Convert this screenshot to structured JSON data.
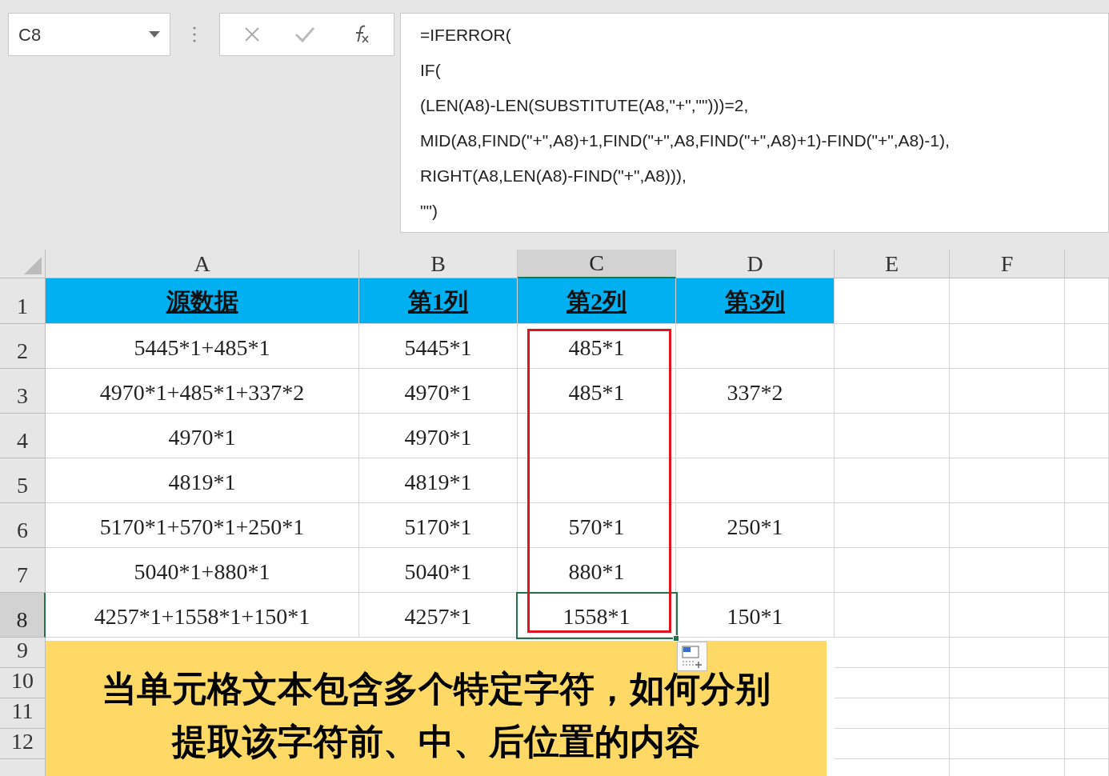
{
  "name_box": {
    "value": "C8"
  },
  "formula_bar": {
    "lines": [
      "=IFERROR(",
      "IF(",
      "(LEN(A8)-LEN(SUBSTITUTE(A8,\"+\",\"\")))=2,",
      "MID(A8,FIND(\"+\",A8)+1,FIND(\"+\",A8,FIND(\"+\",A8)+1)-FIND(\"+\",A8)-1),",
      "RIGHT(A8,LEN(A8)-FIND(\"+\",A8))),",
      "\"\")"
    ]
  },
  "columns": [
    {
      "label": "A",
      "selected": false
    },
    {
      "label": "B",
      "selected": false
    },
    {
      "label": "C",
      "selected": true
    },
    {
      "label": "D",
      "selected": false
    },
    {
      "label": "E",
      "selected": false
    },
    {
      "label": "F",
      "selected": false
    }
  ],
  "rows": [
    {
      "label": "1",
      "kind": "header",
      "selected": false,
      "cells": [
        "源数据",
        "第1列",
        "第2列",
        "第3列"
      ]
    },
    {
      "label": "2",
      "kind": "data",
      "selected": false,
      "cells": [
        "5445*1+485*1",
        "5445*1",
        "485*1",
        null
      ]
    },
    {
      "label": "3",
      "kind": "data",
      "selected": false,
      "cells": [
        "4970*1+485*1+337*2",
        "4970*1",
        "485*1",
        "337*2"
      ]
    },
    {
      "label": "4",
      "kind": "data",
      "selected": false,
      "cells": [
        "4970*1",
        "4970*1",
        null,
        null
      ]
    },
    {
      "label": "5",
      "kind": "data",
      "selected": false,
      "cells": [
        "4819*1",
        "4819*1",
        null,
        null
      ]
    },
    {
      "label": "6",
      "kind": "data",
      "selected": false,
      "cells": [
        "5170*1+570*1+250*1",
        "5170*1",
        "570*1",
        "250*1"
      ]
    },
    {
      "label": "7",
      "kind": "data",
      "selected": false,
      "cells": [
        "5040*1+880*1",
        "5040*1",
        "880*1",
        null
      ]
    },
    {
      "label": "8",
      "kind": "data",
      "selected": true,
      "cells": [
        "4257*1+1558*1+150*1",
        "4257*1",
        "1558*1",
        "150*1"
      ]
    },
    {
      "label": "9",
      "kind": "empty",
      "selected": false
    },
    {
      "label": "10",
      "kind": "empty",
      "selected": false
    },
    {
      "label": "11",
      "kind": "empty",
      "selected": false
    },
    {
      "label": "12",
      "kind": "empty",
      "selected": false
    }
  ],
  "banner": {
    "lines": [
      "当单元格文本包含多个特定字符，如何分别",
      "提取该字符前、中、后位置的内容"
    ]
  }
}
